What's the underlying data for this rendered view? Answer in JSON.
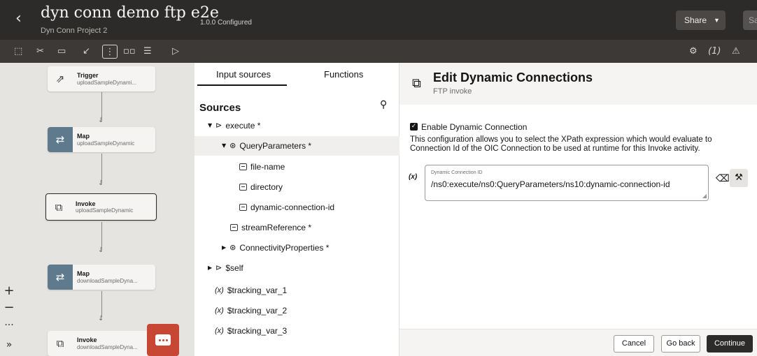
{
  "header": {
    "back_icon": "chevron-left-icon",
    "title": "dyn conn demo ftp e2e",
    "project": "Dyn Conn Project 2",
    "version": "1.0.0 Configured",
    "share_label": "Share",
    "cut_label": "Sa"
  },
  "toolbar": {
    "right_count": "(1)"
  },
  "canvas": {
    "nodes": [
      {
        "title": "Trigger",
        "subtitle": "uploadSampleDynami..."
      },
      {
        "title": "Map",
        "subtitle": "uploadSampleDynamic"
      },
      {
        "title": "Invoke",
        "subtitle": "uploadSampleDynamic"
      },
      {
        "title": "Map",
        "subtitle": "downloadSampleDyna..."
      },
      {
        "title": "Invoke",
        "subtitle": "downloadSampleDyna..."
      }
    ],
    "zoom_in": "+",
    "zoom_out": "−",
    "more": "...",
    "expand": "»"
  },
  "sources": {
    "tabs": [
      "Input sources",
      "Functions"
    ],
    "title": "Sources",
    "tree": [
      {
        "label": "execute *"
      },
      {
        "label": "QueryParameters *"
      },
      {
        "label": "file-name"
      },
      {
        "label": "directory"
      },
      {
        "label": "dynamic-connection-id"
      },
      {
        "label": "streamReference *"
      },
      {
        "label": "ConnectivityProperties *"
      },
      {
        "label": "$self"
      },
      {
        "label": "$tracking_var_1"
      },
      {
        "label": "$tracking_var_2"
      },
      {
        "label": "$tracking_var_3"
      }
    ]
  },
  "editor": {
    "title": "Edit Dynamic Connections",
    "subtitle": "FTP invoke",
    "checkbox_label": "Enable Dynamic Connection",
    "description": "This configuration allows you to select the XPath expression which would evaluate to Connection Id of the OIC Connection to be used at runtime for this Invoke activity.",
    "field_label": "Dynamic Connection ID",
    "field_value": "/ns0:execute/ns0:QueryParameters/ns10:dynamic-connection-id",
    "buttons": {
      "cancel": "Cancel",
      "go_back": "Go back",
      "continue": "Continue"
    }
  }
}
